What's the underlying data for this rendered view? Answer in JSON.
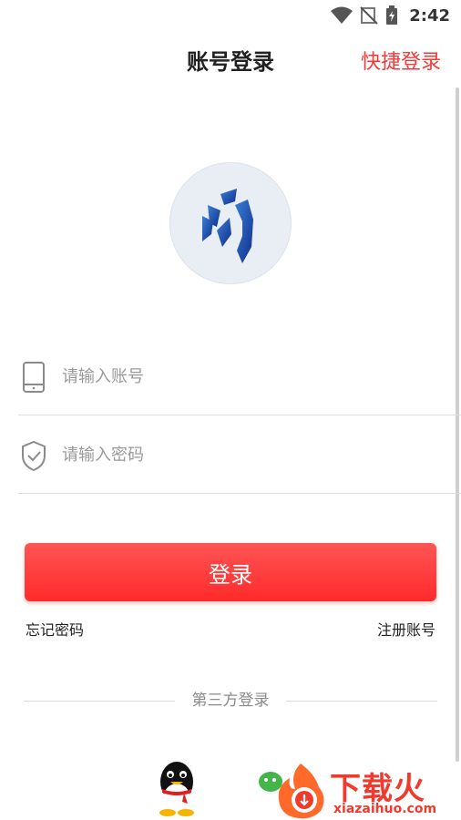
{
  "status_bar": {
    "time": "2:42"
  },
  "header": {
    "title": "账号登录",
    "quick_login": "快捷登录"
  },
  "form": {
    "account_placeholder": "请输入账号",
    "password_placeholder": "请输入密码",
    "login_button": "登录",
    "forgot_password": "忘记密码",
    "register": "注册账号"
  },
  "third_party": {
    "label": "第三方登录"
  },
  "watermark": {
    "title": "下载火",
    "url": "xiazaihuo.com"
  },
  "colors": {
    "accent": "#ff3b3b",
    "quick_login": "#f23a3a"
  }
}
